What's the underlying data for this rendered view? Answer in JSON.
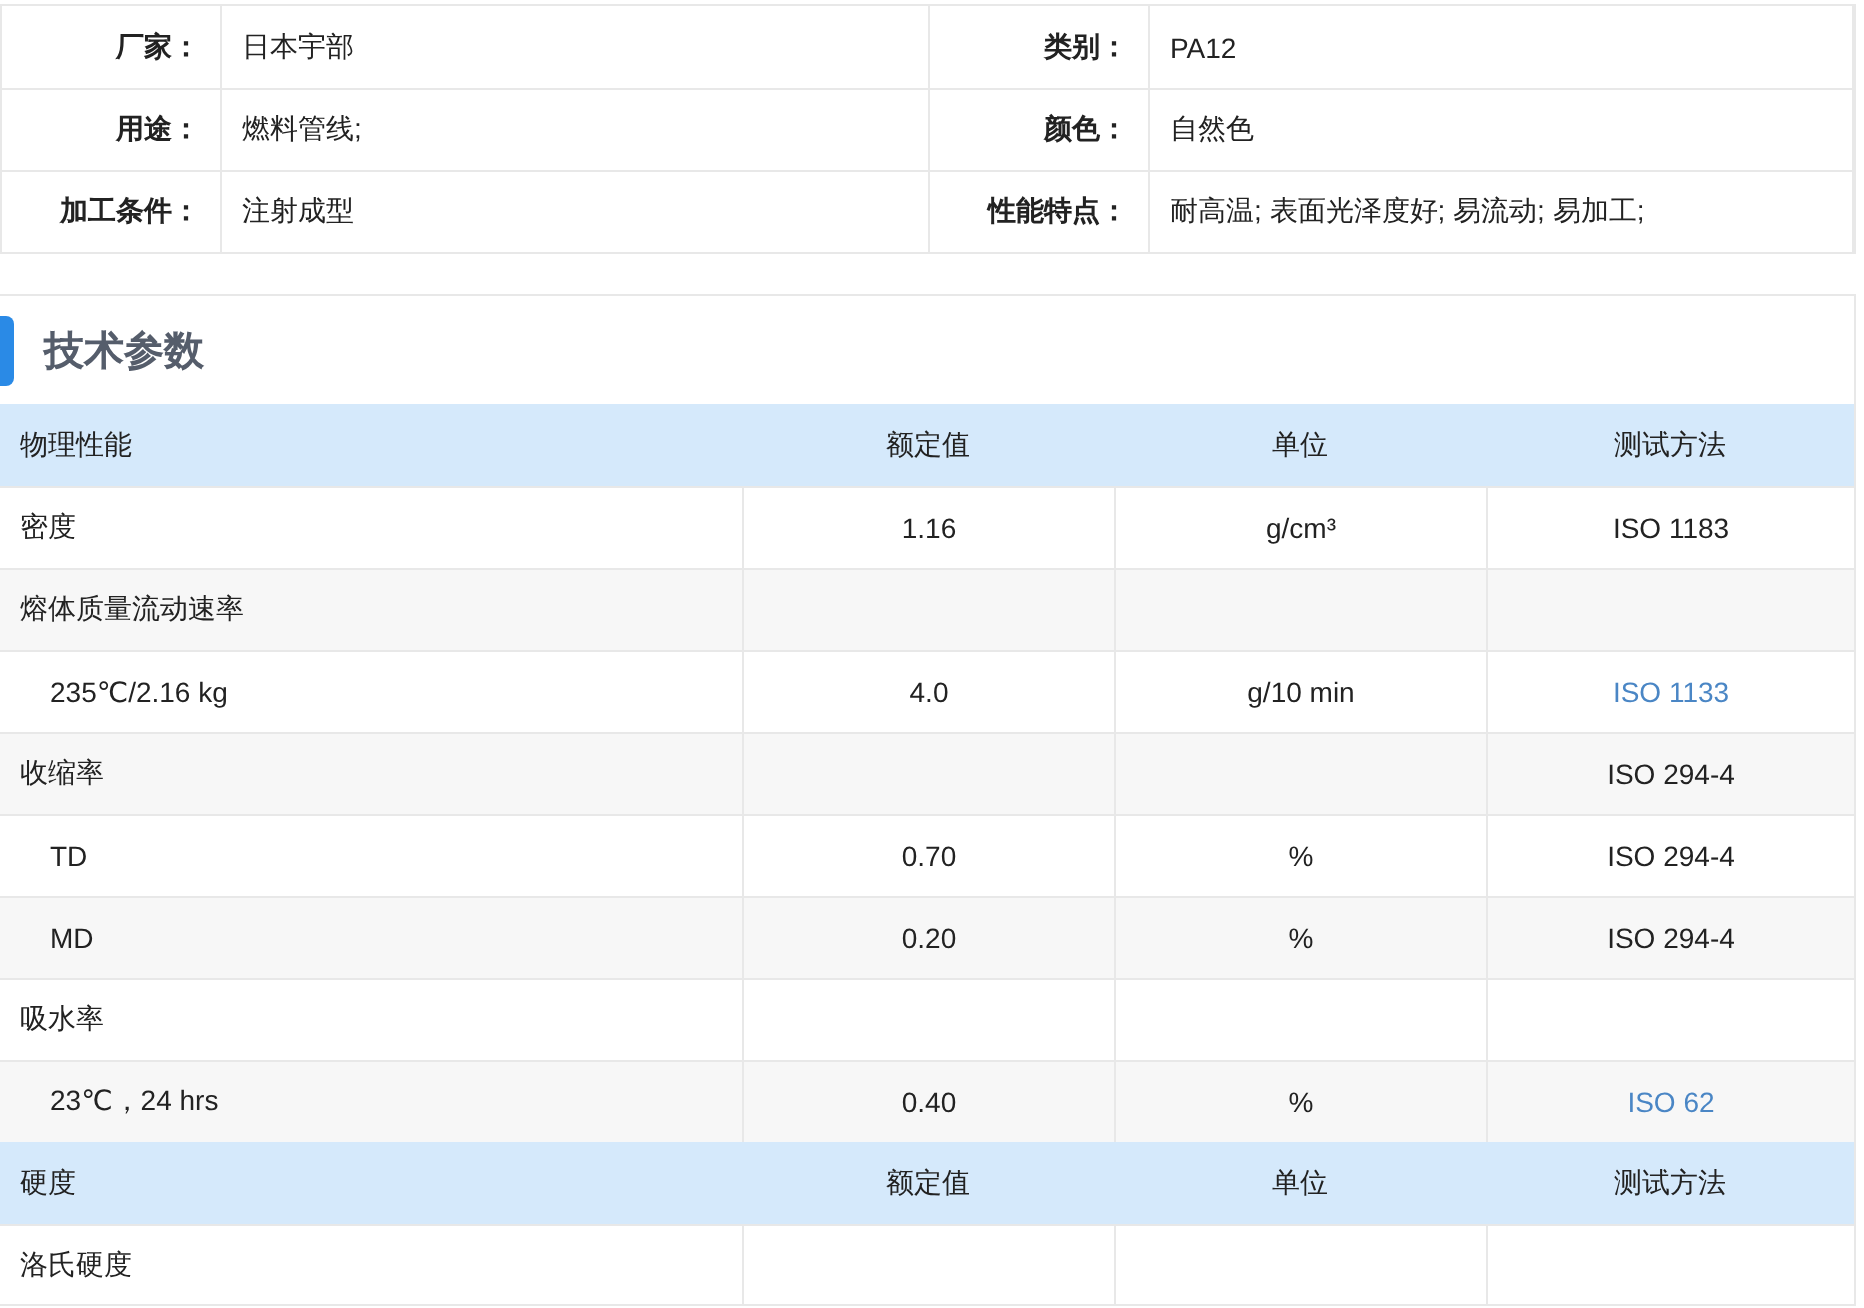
{
  "info": [
    {
      "label": "厂家：",
      "value": "日本宇部",
      "label2": "类别：",
      "value2": "PA12"
    },
    {
      "label": "用途：",
      "value": "燃料管线;",
      "label2": "颜色：",
      "value2": "自然色"
    },
    {
      "label": "加工条件：",
      "value": "注射成型",
      "label2": "性能特点：",
      "value2": "耐高温; 表面光泽度好; 易流动; 易加工;"
    }
  ],
  "section": {
    "title": "技术参数"
  },
  "rows": [
    {
      "kind": "header",
      "cells": [
        "物理性能",
        "额定值",
        "单位",
        "测试方法"
      ]
    },
    {
      "kind": "row",
      "cells": [
        "密度",
        "1.16",
        "g/cm³",
        "ISO 1183"
      ],
      "link": false
    },
    {
      "kind": "row",
      "cells": [
        "熔体质量流动速率",
        "",
        "",
        ""
      ]
    },
    {
      "kind": "sub",
      "cells": [
        "235℃/2.16 kg",
        "4.0",
        "g/10 min",
        "ISO 1133"
      ],
      "link": true
    },
    {
      "kind": "row",
      "cells": [
        "收缩率",
        "",
        "",
        "ISO 294-4"
      ],
      "link": false
    },
    {
      "kind": "sub",
      "cells": [
        "TD",
        "0.70",
        "%",
        "ISO 294-4"
      ],
      "link": false
    },
    {
      "kind": "sub",
      "cells": [
        "MD",
        "0.20",
        "%",
        "ISO 294-4"
      ],
      "link": false
    },
    {
      "kind": "row",
      "cells": [
        "吸水率",
        "",
        "",
        ""
      ]
    },
    {
      "kind": "sub",
      "cells": [
        "23℃，24 hrs",
        "0.40",
        "%",
        "ISO 62"
      ],
      "link": true
    },
    {
      "kind": "header",
      "cells": [
        "硬度",
        "额定值",
        "单位",
        "测试方法"
      ]
    },
    {
      "kind": "row",
      "cells": [
        "洛氏硬度",
        "",
        "",
        ""
      ]
    }
  ]
}
